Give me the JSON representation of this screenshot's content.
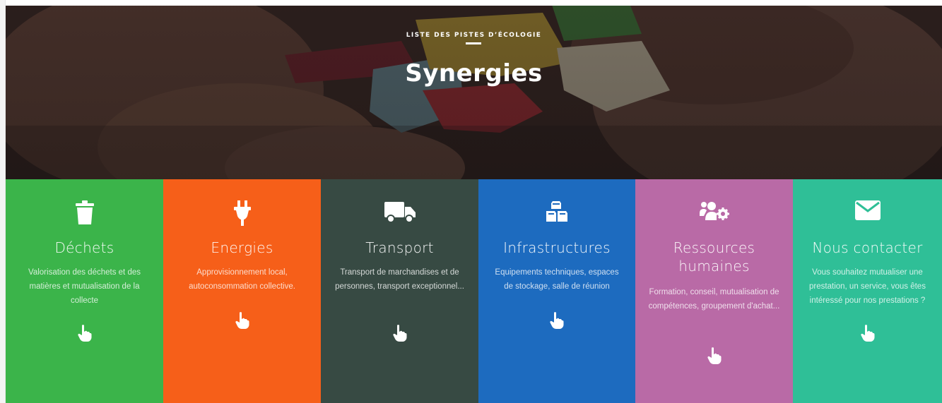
{
  "hero": {
    "kicker": "LISTE DES PISTES D’ÉCOLOGIE",
    "title": "Synergies"
  },
  "colors": {
    "dechets": "#3bb44a",
    "energies": "#f65f19",
    "transport": "#374a43",
    "infrastructures": "#1d6bbf",
    "ressources": "#b96aa6",
    "contact": "#2fbf97"
  },
  "tiles": [
    {
      "icon": "trash-icon",
      "title": "Déchets",
      "desc": "Valorisation des déchets et des matières et mutualisation de la collecte"
    },
    {
      "icon": "plug-icon",
      "title": "Energies",
      "desc": "Approvisionnement local, autoconsommation collective."
    },
    {
      "icon": "truck-icon",
      "title": "Transport",
      "desc": "Transport de marchandises et de personnes, transport exceptionnel..."
    },
    {
      "icon": "cubes-icon",
      "title": "Infrastructures",
      "desc": "Equipements techniques, espaces de stockage, salle de réunion"
    },
    {
      "icon": "users-cog-icon",
      "title": "Ressources humaines",
      "desc": "Formation, conseil, mutualisation de compétences, groupement d'achat..."
    },
    {
      "icon": "envelope-icon",
      "title": "Nous contacter",
      "desc": "Vous souhaitez mutualiser une prestation, un service, vous êtes intéressé pour nos prestations ?"
    }
  ]
}
